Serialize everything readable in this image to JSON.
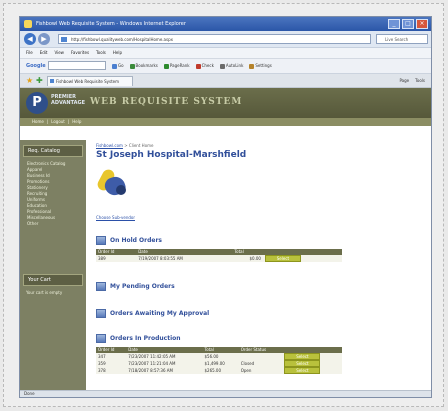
{
  "browser": {
    "window_title": "Fishbowl Web Requisite System - Windows Internet Explorer",
    "address": "http://fishbowl.qualityweb.com/HospitalHome.aspx",
    "search_placeholder": "Live Search",
    "menu": [
      "File",
      "Edit",
      "View",
      "Favorites",
      "Tools",
      "Help"
    ],
    "google_label": "Google",
    "google_tools": [
      "Go",
      "Bookmarks",
      "PageRank",
      "Check",
      "AutoLink",
      "Settings"
    ],
    "tab_title": "Fishbowl Web Requisite System",
    "page_tools": [
      "Page",
      "Tools"
    ],
    "status": "Done"
  },
  "banner": {
    "logo_letter": "P",
    "org_line1": "PREMIER",
    "org_line2": "ADVANTAGE",
    "system_name": "WEB REQUISITE SYSTEM"
  },
  "subnav": [
    "Home",
    "|",
    "Logout",
    "|",
    "Help"
  ],
  "sidebar": {
    "catalog_title": "Req. Catalog",
    "items": [
      "Electronics Catalog",
      "Apparel",
      "Business Id",
      "Promotions",
      "Stationery",
      "Recruiting",
      "Uniforms",
      "Education",
      "Professional",
      "Miscellaneous",
      "Other"
    ],
    "cart_title": "Your Cart",
    "cart_text": "Your cart is empty"
  },
  "page": {
    "breadcrumb_link": "Fishbowl.com",
    "breadcrumb_rest": " > Client Home",
    "title": "St Joseph Hospital-Marshfield",
    "choose_link": "Choose Sub-vendor"
  },
  "sections": {
    "on_hold": "On Hold Orders",
    "pending": "My Pending Orders",
    "approval": "Orders Awaiting My Approval",
    "production": "Orders In Production"
  },
  "on_hold_orders": {
    "headers": [
      "Order Id",
      "Date",
      "Total",
      ""
    ],
    "rows": [
      [
        "389",
        "7/19/2007 8:03:55 AM",
        "$0.00",
        "Select"
      ]
    ]
  },
  "production_orders": {
    "headers": [
      "Order Id",
      "Date",
      "Total",
      "Order Status",
      ""
    ],
    "rows": [
      [
        "347",
        "7/23/2007 11:42:05 AM",
        "$56.00",
        "",
        "Select"
      ],
      [
        "359",
        "7/23/2007 11:21:04 AM",
        "$1,499.00",
        "Closed",
        "Select"
      ],
      [
        "378",
        "7/18/2007 8:57:36 AM",
        "$265.00",
        "Open",
        "Select"
      ]
    ]
  }
}
